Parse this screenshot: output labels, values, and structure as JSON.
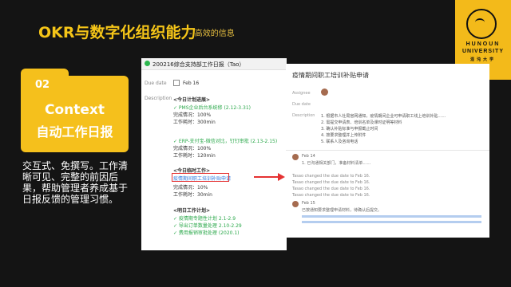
{
  "slide": {
    "title": "OKR与数字化组织能力",
    "subtitle": "- 高效的信息"
  },
  "logo": {
    "line1": "HUNOUN",
    "line2": "UNIVERSITY",
    "line3": "混沌大学"
  },
  "folder": {
    "number": "02",
    "title_en": "Context",
    "title_zh": "自动工作日报"
  },
  "description": "交互式、免撰写。工作清晰可见、完整的前因后果，帮助管理者养成基于日报反馈的管理习惯。",
  "daily_report": {
    "header": "200216综合支持部工作日报（Tao）",
    "due_date_label": "Due date",
    "due_date": "Feb 16",
    "description_label": "Description",
    "today_done": "<今日计划进展>",
    "items_done": [
      {
        "text": "✓ PMS企业后台系统修 (2.12-3.31)",
        "rate": "完成情况：100%",
        "hours": "工作耗时：300min"
      },
      {
        "text": "✓ ERP-支付宝-微信对比，钉钉审批 (2.13-2.15)",
        "rate": "完成情况：100%",
        "hours": "工作耗时：120min"
      }
    ],
    "temp_work": "<今日临时工作>",
    "temp_item": "疫情期间职工培训补贴申请",
    "temp_rate": "完成情况：10%",
    "temp_hours": "工作耗时：30min",
    "tomorrow": "<明日工作计划>",
    "tomorrow_items": [
      "✓ 疫情期专题性计划 2.1-2.9",
      "✓ 导出订单数量处理 2.10-2.29",
      "✓ 费用报销审批处理 (2020.1)"
    ]
  },
  "task_card": {
    "title": "疫情期间职工培训补贴申请",
    "assignee_label": "Assignee",
    "due_label": "Due date",
    "desc_label": "Description",
    "desc_lines": [
      "1. 根据市人社局官网通知，疫情期间企业可申请职工线上培训补贴……",
      "2. 需提交申请表、培训名单及课时证明等材料",
      "3. 确认补贴标准与申报截止时间",
      "4. 按要求整理并上传附件",
      "5. 联系人及咨询电话"
    ],
    "comments": [
      "Feb 14",
      "1. 已沟通相关部门，准备材料清单……",
      "Tasao changed the due date to Feb 16.",
      "Tasao changed the due date to Feb 16.",
      "Tasao changed the due date to Feb 16.",
      "Tasao changed the due date to Feb 16.",
      "Feb 15",
      "已按通知要求整理申请材料，待确认后提交。"
    ]
  }
}
